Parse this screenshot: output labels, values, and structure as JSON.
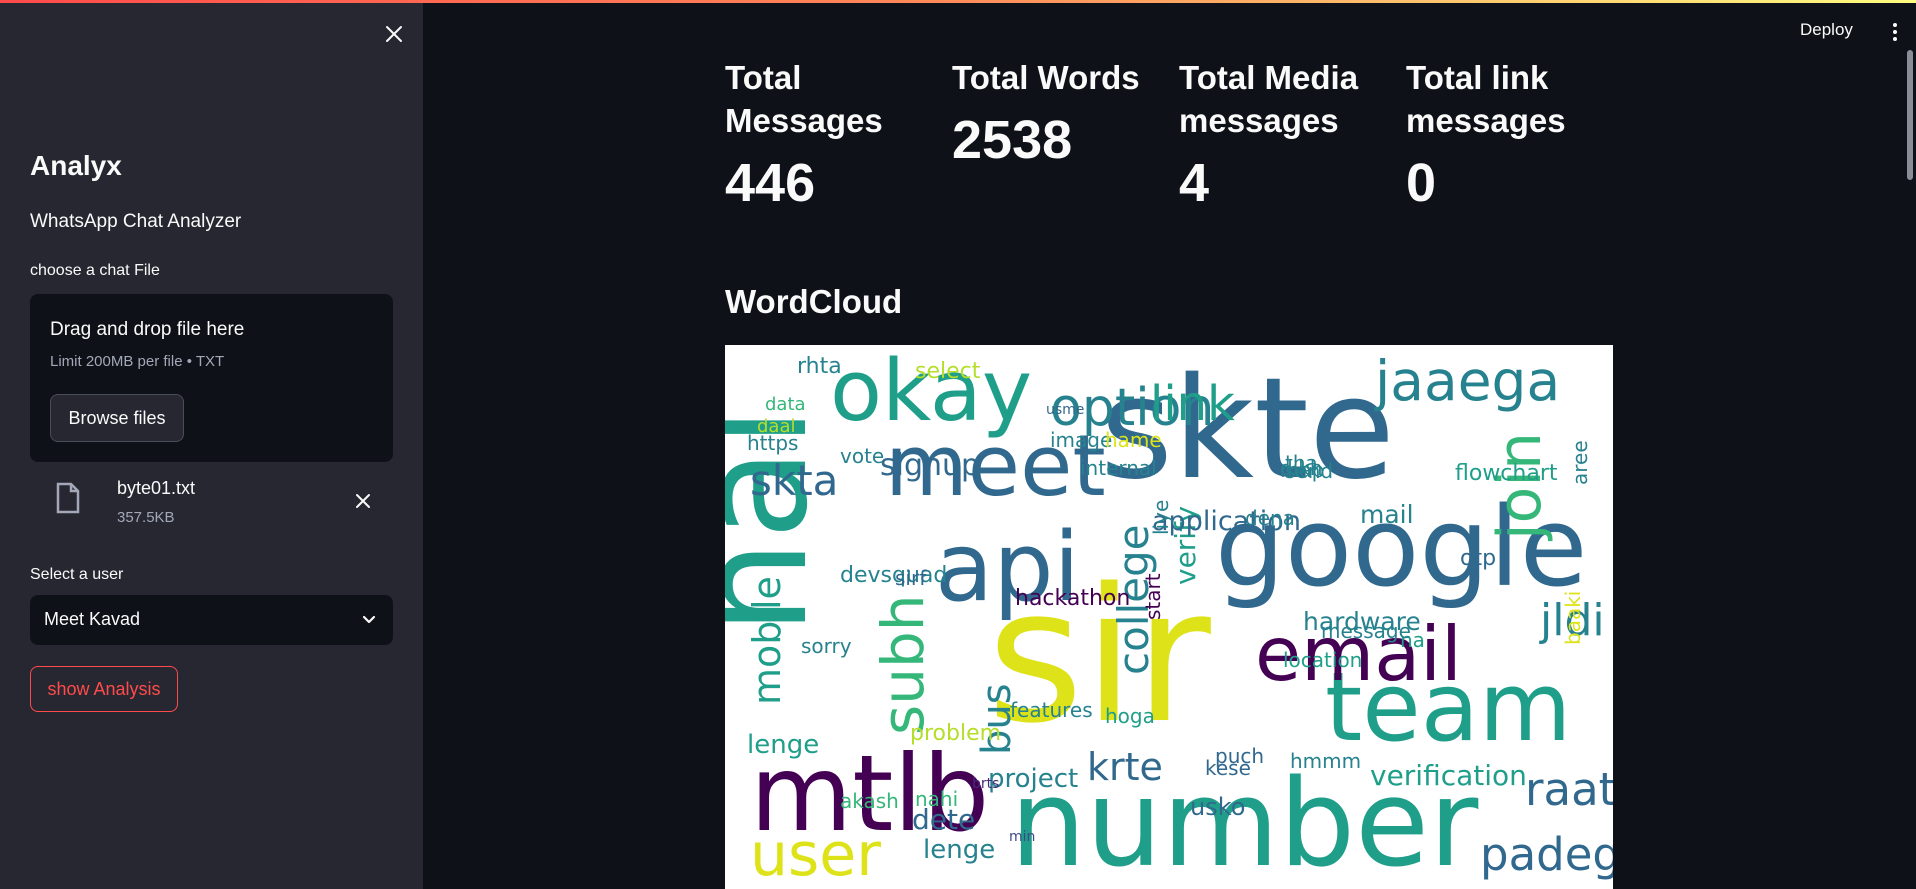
{
  "header": {
    "deploy_label": "Deploy"
  },
  "sidebar": {
    "title": "Analyx",
    "subtitle": "WhatsApp Chat Analyzer",
    "uploader_label": "choose a chat File",
    "drop_text": "Drag and drop file here",
    "limit_text": "Limit 200MB per file • TXT",
    "browse_label": "Browse files",
    "file": {
      "name": "byte01.txt",
      "size": "357.5KB"
    },
    "select_label": "Select a user",
    "selected_user": "Meet Kavad",
    "show_analysis_label": "show Analysis"
  },
  "metrics": [
    {
      "label": "Total Messages",
      "value": "446"
    },
    {
      "label": "Total Words",
      "value": "2538"
    },
    {
      "label": "Total Media messages",
      "value": "4"
    },
    {
      "label": "Total link messages",
      "value": "0"
    }
  ],
  "wordcloud": {
    "title": "WordCloud",
    "words": [
      "sir",
      "skte",
      "number",
      "hai",
      "google",
      "api",
      "team",
      "meet",
      "okay",
      "mtlb",
      "email",
      "user",
      "join",
      "jaaega",
      "subh",
      "option",
      "link",
      "college",
      "skta",
      "padega",
      "raat",
      "jldi",
      "mobile",
      "bus",
      "krte",
      "verification",
      "signup",
      "verify",
      "hardware",
      "usko",
      "dete",
      "project",
      "lenge",
      "lenge",
      "select",
      "application",
      "mail",
      "hackathon",
      "devsquad",
      "data",
      "https",
      "daal",
      "rhta",
      "aree",
      "flowchart",
      "otp",
      "na",
      "message",
      "start",
      "hoga",
      "kese",
      "problem",
      "sorry",
      "features",
      "nahi",
      "akash",
      "puch",
      "hmmm",
      "location",
      "baaki",
      "dena",
      "liye",
      "sirf",
      "internal",
      "image",
      "hame",
      "vote",
      "tha",
      "map",
      "send",
      "dikh",
      "brts",
      "min",
      "usme"
    ],
    "colors": [
      "#440154",
      "#482878",
      "#3e4989",
      "#31688e",
      "#26828e",
      "#1f9e89",
      "#35b779",
      "#6ece58",
      "#b5de2b",
      "#dde318"
    ]
  }
}
